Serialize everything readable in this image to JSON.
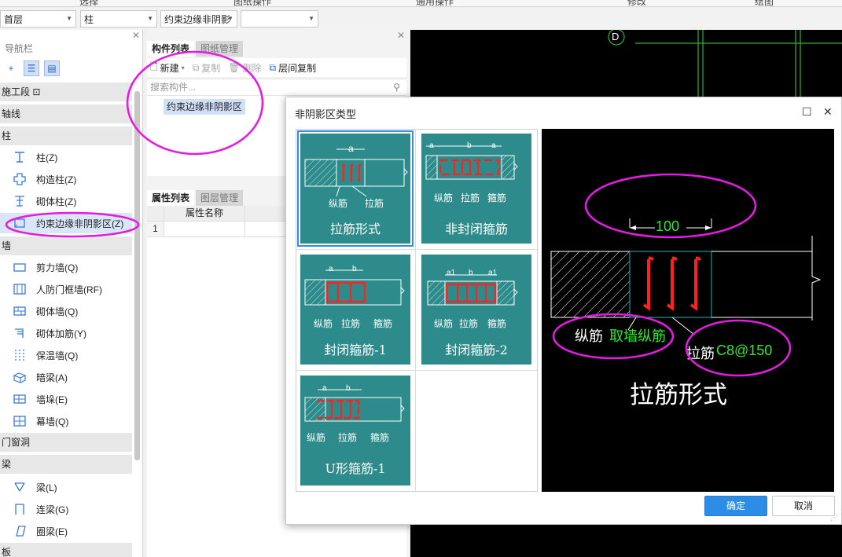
{
  "ribbon_fragments": [
    "选择",
    "图纸操作",
    "通用操作",
    "修改",
    "绘图"
  ],
  "combos": {
    "floor": "首层",
    "category": "柱",
    "type": "约束边缘非阴影",
    "blank": ""
  },
  "nav": {
    "title": "导航栏",
    "categories": {
      "segment": "施工段",
      "axis": "轴线",
      "column": "柱",
      "wall": "墙",
      "opening": "门窗洞",
      "beam": "梁",
      "slab": "板"
    },
    "column_items": [
      {
        "label": "柱(Z)",
        "icon": "column-icon"
      },
      {
        "label": "构造柱(Z)",
        "icon": "constructional-column-icon"
      },
      {
        "label": "砌体柱(Z)",
        "icon": "masonry-column-icon"
      },
      {
        "label": "约束边缘非阴影区(Z)",
        "icon": "non-shadow-zone-icon"
      }
    ],
    "wall_items": [
      {
        "label": "剪力墙(Q)",
        "icon": "shear-wall-icon"
      },
      {
        "label": "人防门框墙(RF)",
        "icon": "civil-defense-door-wall-icon"
      },
      {
        "label": "砌体墙(Q)",
        "icon": "masonry-wall-icon"
      },
      {
        "label": "砌体加筋(Y)",
        "icon": "masonry-reinforcement-icon"
      },
      {
        "label": "保温墙(Q)",
        "icon": "insulation-wall-icon"
      },
      {
        "label": "暗梁(A)",
        "icon": "hidden-beam-icon"
      },
      {
        "label": "墙垛(E)",
        "icon": "wall-pier-icon"
      },
      {
        "label": "幕墙(Q)",
        "icon": "curtain-wall-icon"
      }
    ],
    "beam_items": [
      {
        "label": "梁(L)",
        "icon": "beam-icon"
      },
      {
        "label": "连梁(G)",
        "icon": "coupling-beam-icon"
      },
      {
        "label": "圈梁(E)",
        "icon": "ring-beam-icon"
      }
    ]
  },
  "component_panel": {
    "tabs": [
      "构件列表",
      "图纸管理"
    ],
    "toolbar": {
      "new": "新建",
      "copy": "复制",
      "delete": "删除",
      "floor_copy": "层间复制"
    },
    "search_placeholder": "搜索构件...",
    "items": [
      "约束边缘非阴影区"
    ],
    "prop_tabs": [
      "属性列表",
      "图层管理"
    ],
    "prop_header": "属性名称",
    "prop_row_index": "1"
  },
  "canvas": {
    "axis_label": "D"
  },
  "dialog": {
    "title": "非阴影区类型",
    "options": [
      {
        "name": "拉筋形式",
        "sublabels": [
          "纵筋",
          "拉筋"
        ],
        "dims": [
          "a"
        ]
      },
      {
        "name": "非封闭箍筋",
        "sublabels": [
          "纵筋",
          "拉筋",
          "箍筋"
        ],
        "dims": [
          "a",
          "b",
          "a"
        ]
      },
      {
        "name": "封闭箍筋-1",
        "sublabels": [
          "纵筋",
          "拉筋",
          "箍筋"
        ],
        "dims": [
          "a",
          "b"
        ]
      },
      {
        "name": "封闭箍筋-2",
        "sublabels": [
          "纵筋",
          "拉筋",
          "箍筋"
        ],
        "dims": [
          "a1",
          "b",
          "a1"
        ]
      },
      {
        "name": "U形箍筋-1",
        "sublabels": [
          "纵筋",
          "拉筋",
          "箍筋"
        ],
        "dims": [
          "a",
          "b"
        ]
      }
    ],
    "selected_index": 0,
    "preview": {
      "dimension": "100",
      "longitudinal_label": "纵筋",
      "longitudinal_value": "取墙纵筋",
      "tie_label": "拉筋",
      "tie_value": "C8@150",
      "title": "拉筋形式"
    },
    "ok": "确定",
    "cancel": "取消"
  },
  "colors": {
    "tile": "#2e8b8b",
    "accent": "#2b8de6",
    "annotation": "#e21ce0",
    "green_text": "#2ee82e",
    "rebar": "#ff2020"
  }
}
